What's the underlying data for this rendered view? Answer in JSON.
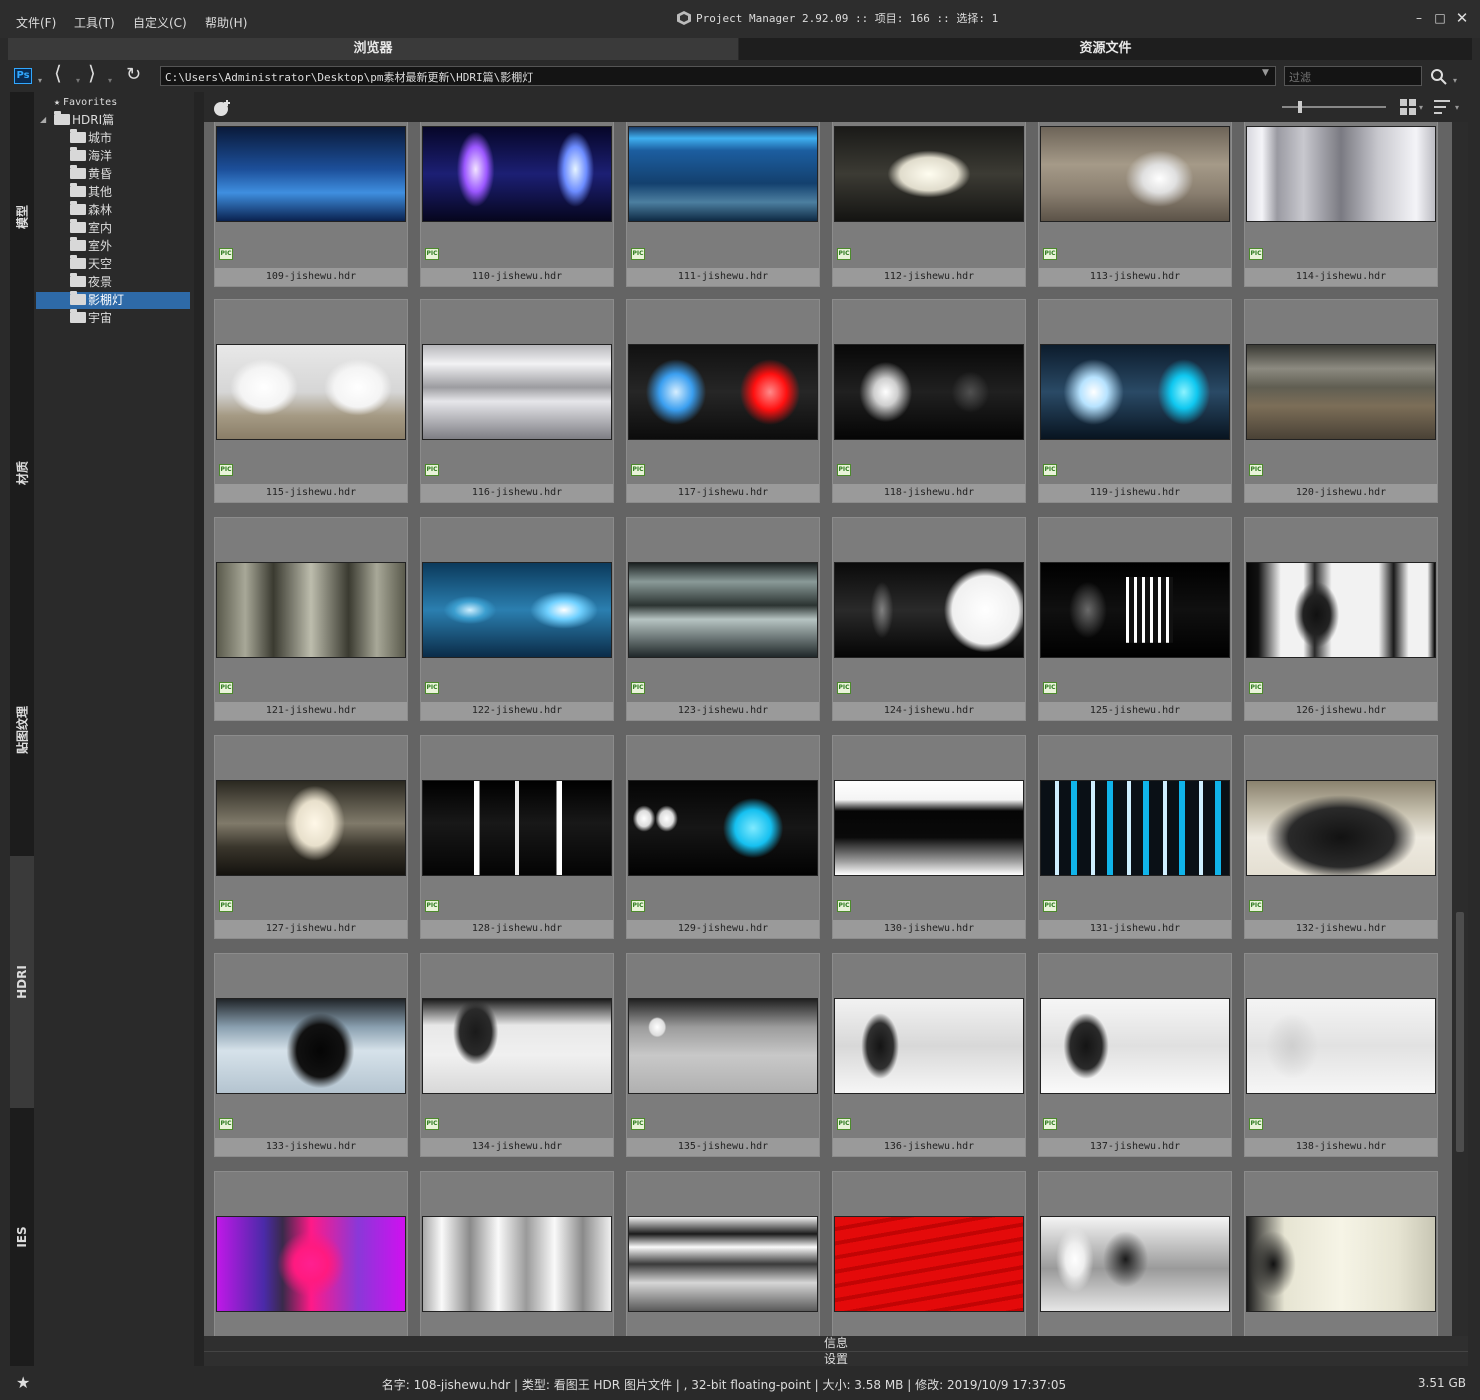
{
  "menu": [
    "文件(F)",
    "工具(T)",
    "自定义(C)",
    "帮助(H)"
  ],
  "title": "Project Manager 2.92.09  :: 项目: 166  :: 选择: 1",
  "tabs": {
    "browser": "浏览器",
    "assets": "资源文件"
  },
  "toolbar": {
    "path": "C:\\Users\\Administrator\\Desktop\\pm素材最新更新\\HDRI篇\\影棚灯",
    "filter_placeholder": "过滤"
  },
  "side_tabs": [
    "模型",
    "材质",
    "贴图纹理",
    "HDRI",
    "IES"
  ],
  "tree": {
    "favorites": "Favorites",
    "root": "HDRI篇",
    "children": [
      "城市",
      "海洋",
      "黄昏",
      "其他",
      "森林",
      "室内",
      "室外",
      "天空",
      "夜景",
      "影棚灯",
      "宇宙"
    ],
    "selected_index": 9
  },
  "badge": "PIC",
  "items": [
    {
      "name": "109-jishewu.hdr",
      "bg": "linear-gradient(180deg,#0a1a3a 0%,#1c4f9a 45%,#3f8fe0 70%,#0a2250 100%)"
    },
    {
      "name": "110-jishewu.hdr",
      "bg": "radial-gradient(ellipse 10% 40% at 28% 45%,#f2e4ff 0%,#9b57ff 60%,transparent 100%),radial-gradient(ellipse 10% 40% at 81% 45%,#e6f4ff 0%,#6c8cff 60%,transparent 100%),linear-gradient(180deg,#060628,#1c1f74 50%,#06061e)"
    },
    {
      "name": "111-jishewu.hdr",
      "bg": "linear-gradient(180deg,#1a3a66 0%,#3fb0f0 12%,#1c5ea0 25%,#13406e 60%,#4c7fa0 80%,#0e2a44 100%)"
    },
    {
      "name": "112-jishewu.hdr",
      "bg": "radial-gradient(ellipse 22% 25% at 50% 50%,#fffdf0 0%,#e0dccc 70%,transparent 100%),linear-gradient(180deg,#1a1a18,#3c3b34 50%,#141412)"
    },
    {
      "name": "113-jishewu.hdr",
      "bg": "radial-gradient(ellipse 18% 30% at 63% 55%,#ffffff 0%,#e0e0e0 50%,transparent 100%),linear-gradient(180deg,#6d6458,#a59a88 40%,#8a7f70 70%,#5c5348)"
    },
    {
      "name": "114-jishewu.hdr",
      "bg": "linear-gradient(90deg,#d8d8de 0%,#f4f4f8 8%,#9a9aa2 16%,#c8c8ce 30%,#7a7a82 50%,#c8c8ce 70%,#f4f4f8 90%,#bcbcc2 100%)"
    },
    {
      "name": "115-jishewu.hdr",
      "bg": "radial-gradient(ellipse 18% 30% at 25% 45%,#ffffff 0%,#f4f4f4 70%,transparent 100%),radial-gradient(ellipse 18% 30% at 75% 45%,#ffffff 0%,#f4f4f4 70%,transparent 100%),linear-gradient(180deg,#e8e8e8 0%,#d6d6d6 50%,#a59a84 75%,#8a7e68 100%)"
    },
    {
      "name": "116-jishewu.hdr",
      "bg": "linear-gradient(180deg,#b8b8bc 0%,#f2f2f4 20%,#9c9ca0 45%,#e6e6ea 60%,#7e7e84 100%)"
    },
    {
      "name": "117-jishewu.hdr",
      "bg": "radial-gradient(ellipse 16% 35% at 25% 50%,#d6eeff 0%,#3b9ff0 55%,transparent 100%),radial-gradient(ellipse 16% 35% at 75% 50%,#ff8a8a 0%,#ff1010 55%,transparent 100%),linear-gradient(180deg,#111,#262626 50%,#0c0c0c)"
    },
    {
      "name": "118-jishewu.hdr",
      "bg": "radial-gradient(ellipse 14% 32% at 27% 50%,#ffffff 0%,#cfcfcf 45%,transparent 100%),radial-gradient(ellipse 10% 22% at 72% 50%,#505050 0%,transparent 100%),linear-gradient(180deg,#080808,#202020 50%,#050505)"
    },
    {
      "name": "119-jishewu.hdr",
      "bg": "radial-gradient(ellipse 16% 35% at 28% 50%,#ffffff 0%,#b7e3ff 45%,transparent 100%),radial-gradient(ellipse 14% 35% at 76% 50%,#8cf3ff 0%,#0fc8f0 50%,transparent 100%),linear-gradient(180deg,#0c1c2c,#2a4a66 50%,#081420)"
    },
    {
      "name": "120-jishewu.hdr",
      "bg": "linear-gradient(180deg,#3a3a34 0%,#8c8a80 25%,#605e52 45%,#7c6e58 65%,#4a4236 100%)"
    },
    {
      "name": "121-jishewu.hdr",
      "bg": "linear-gradient(90deg,#5a5a4c,#a8a898 15%,#3a3a30 30%,#bdbdad 50%,#3a3a30 70%,#a8a898 85%,#5a5a4c)"
    },
    {
      "name": "122-jishewu.hdr",
      "bg": "radial-gradient(ellipse 18% 20% at 75% 50%,#ffffff 0%,#6fd0ff 50%,transparent 100%),radial-gradient(ellipse 14% 15% at 25% 50%,#cfefff 0%,#3c9fd0 60%,transparent 100%),linear-gradient(180deg,#0b3a5c,#2b7fb0 50%,#0b2c48)"
    },
    {
      "name": "123-jishewu.hdr",
      "bg": "linear-gradient(180deg,#1a2020 0%,#8a9a98 20%,#2c3432 45%,#b6c4c2 60%,#20282a 100%)"
    },
    {
      "name": "124-jishewu.hdr",
      "bg": "radial-gradient(ellipse 22% 45% at 80% 50%,#ffffff 0%,#f0f0f0 80%,transparent 100%),radial-gradient(ellipse 6% 30% at 25% 50%,#808080 0%,transparent 100%),linear-gradient(180deg,#0a0a0a,#2a2a2a 50%,#050505)"
    },
    {
      "name": "125-jishewu.hdr",
      "bg": "repeating-linear-gradient(90deg,#ffffff 0px,#ffffff 3px,#111 3px,#111 8px) 60% 50%/25% 70% no-repeat,radial-gradient(ellipse 10% 30% at 25% 50%,#6a6a6a 0%,transparent 100%),linear-gradient(180deg,#000,#101010 50%,#000)"
    },
    {
      "name": "126-jishewu.hdr",
      "bg": "radial-gradient(ellipse 12% 35% at 37% 55%,#111 0%,#222 60%,transparent 100%),linear-gradient(90deg,#050505 0%,#111 6%,#f2f2f2 18%,#f2f2f2 30%,#2a2a2a 36%,#f2f2f2 45%,#f2f2f2 70%,#1a1a1a 78%,#f2f2f2 86%,#f2f2f2 96%,#000 100%)"
    },
    {
      "name": "127-jishewu.hdr",
      "bg": "radial-gradient(ellipse 16% 40% at 52% 45%,#fff8e8 0%,#e8e0cc 60%,transparent 100%),linear-gradient(180deg,#2a2820,#807a6a 45%,#3a362c 70%,#14120e)"
    },
    {
      "name": "128-jishewu.hdr",
      "bg": "linear-gradient(90deg,transparent 27%,#fff 27%,#fff 30%,transparent 30%,transparent 49%,#eee 49%,#eee 51%,transparent 51%,transparent 71%,#fff 71%,#fff 74%,transparent 74%),linear-gradient(180deg,#000 0%,#181818 45%,#040404 100%)"
    },
    {
      "name": "129-jishewu.hdr",
      "bg": "radial-gradient(ellipse 16% 32% at 66% 50%,#7feaff 0%,#15c0f0 60%,transparent 100%),radial-gradient(ellipse 6% 14% at 8% 40%,#fff 0%,#ddd 60%,transparent 100%),radial-gradient(ellipse 6% 14% at 20% 40%,#fff 0%,#ddd 60%,transparent 100%),linear-gradient(180deg,#050505,#161616 50%,#020202)"
    },
    {
      "name": "130-jishewu.hdr",
      "bg": "linear-gradient(180deg,#ffffff 0%,#f4f4f4 20%,#050505 32%,#0a0a0a 60%,#9a9a9a 85%,#ffffff 100%)"
    },
    {
      "name": "131-jishewu.hdr",
      "bg": "repeating-linear-gradient(90deg,#0a1016 0px,#0a1016 14px,#cfefff 14px,#cfefff 18px,#0a1016 18px,#0a1016 30px,#10b4ea 30px,#10b4ea 36px),linear-gradient(180deg,#051018,#081820)"
    },
    {
      "name": "132-jishewu.hdr",
      "bg": "radial-gradient(ellipse 40% 45% at 50% 60%,#121212 0%,#2a2a2a 70%,transparent 100%),linear-gradient(180deg,#8a826e,#c8c2b0 35%,#eeeae0 60%,#e4dfd2 100%)"
    },
    {
      "name": "133-jishewu.hdr",
      "bg": "radial-gradient(ellipse 18% 40% at 55% 55%,#050505 0%,#111 70%,transparent 100%),linear-gradient(180deg,#202428 0%,#8aa0b0 30%,#d6e2ea 55%,#b4c4d0 100%)"
    },
    {
      "name": "134-jishewu.hdr",
      "bg": "radial-gradient(ellipse 12% 35% at 28% 35%,#1a1a1a 0%,#2a2a2a 70%,transparent 100%),linear-gradient(180deg,#1a1a1a 0%,#e8e8e8 28%,#f0f0f0 60%,#d8d8d8 100%)"
    },
    {
      "name": "135-jishewu.hdr",
      "bg": "radial-gradient(ellipse 8% 18% at 15% 30%,#fff 0%,#ddd 50%,transparent 60%),linear-gradient(180deg,#202020 0%,#9c9c9c 30%,#c8c8c8 60%,#b0b0b0 100%)"
    },
    {
      "name": "136-jishewu.hdr",
      "bg": "radial-gradient(ellipse 10% 35% at 24% 50%,#141414 0%,#303030 70%,transparent 100%),linear-gradient(180deg,#f2f2f2,#d8d8d8 50%,#f6f6f6)"
    },
    {
      "name": "137-jishewu.hdr",
      "bg": "radial-gradient(ellipse 12% 35% at 24% 50%,#141414 0%,#2a2a2a 70%,transparent 100%),linear-gradient(180deg,#f6f6f6,#e0e0e0 50%,#fafafa)"
    },
    {
      "name": "138-jishewu.hdr",
      "bg": "radial-gradient(ellipse 14% 35% at 24% 50%,#cfcfcf 0%,transparent 100%),linear-gradient(180deg,#f4f4f4,#e2e2e2 50%,#f6f6f6)"
    },
    {
      "name": "",
      "bg": "radial-gradient(ellipse 18% 35% at 50% 50%,#ff2090 0%,#ff1a80 50%,transparent 100%),linear-gradient(90deg,#c018e8,#4a2aa8 25%,#3a2a4a 35%,#ff1a88 50%,#8a38d8 75%,#d010f0)"
    },
    {
      "name": "",
      "bg": "linear-gradient(90deg,#a8a8a8,#fafafa 10%,#8a8a8a 25%,#fafafa 40%,#9a9a9a 55%,#fafafa 70%,#8a8a8a 85%,#efefef)"
    },
    {
      "name": "",
      "bg": "linear-gradient(180deg,#f0f0f0 0%,#1a1a1a 18%,#fafafa 32%,#3a3a3a 50%,#d6d6d6 70%,#5a5a5a 100%)"
    },
    {
      "name": "",
      "bg": "repeating-linear-gradient(170deg,#e40a0a 0px,#e40a0a 10px,#c20404 10px,#c20404 14px)"
    },
    {
      "name": "",
      "bg": "radial-gradient(ellipse 10% 35% at 18% 45%,#fff 0%,#eee 50%,transparent 100%),radial-gradient(ellipse 12% 30% at 45% 45%,#1a1a1a 0%,transparent 100%),linear-gradient(180deg,#f4f4f4,#9a9a9a 55%,#e6e6e6)"
    },
    {
      "name": "",
      "bg": "radial-gradient(ellipse 12% 35% at 14% 50%,#111 0%,transparent 100%),linear-gradient(90deg,#1a1a1a,#e6e4d2 20%,#f6f4e6 50%,#e6e4d2 80%,#c8c6b4)"
    }
  ],
  "bottom": {
    "info": "信息",
    "settings": "设置"
  },
  "status": {
    "details": "名字: 108-jishewu.hdr | 类型: 看图王 HDR 图片文件 | , 32-bit floating-point | 大小: 3.58 MB | 修改: 2019/10/9 17:37:05",
    "disk": "3.51 GB"
  },
  "icons": [
    "ps-icon",
    "back-arrow-icon",
    "forward-arrow-icon",
    "refresh-icon",
    "search-icon",
    "zoom-slider-icon",
    "grid-view-icon",
    "sort-icon",
    "star-icon",
    "add-folder-icon",
    "app-logo-icon",
    "minimize-icon",
    "maximize-icon",
    "close-icon"
  ]
}
